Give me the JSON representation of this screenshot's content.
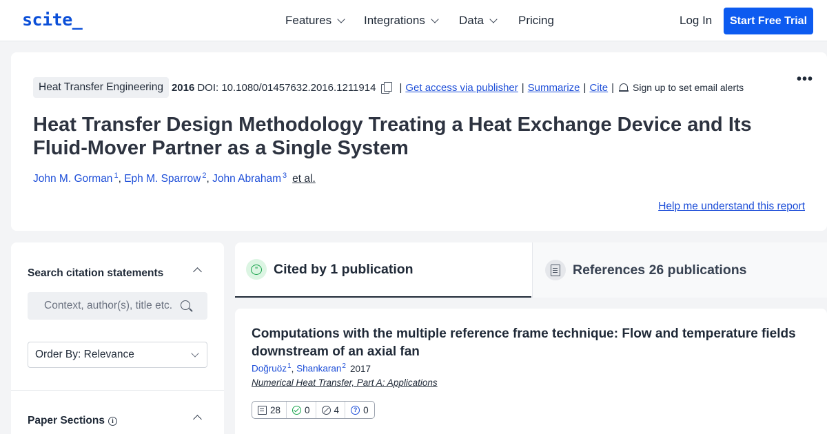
{
  "nav": {
    "logo": "scite_",
    "features": "Features",
    "integrations": "Integrations",
    "data": "Data",
    "pricing": "Pricing",
    "login": "Log In",
    "trial": "Start Free Trial"
  },
  "paper": {
    "journal": "Heat Transfer Engineering",
    "year": "2016",
    "doi": "DOI: 10.1080/01457632.2016.1211914",
    "links": {
      "access": "Get access via publisher",
      "summarize": "Summarize",
      "cite": "Cite"
    },
    "alerts": "Sign up to set email alerts",
    "more": "•••",
    "title": "Heat Transfer Design Methodology Treating a Heat Exchange Device and Its Fluid-Mover Partner as a Single System",
    "authors": [
      {
        "name": "John M. Gorman",
        "sup": "1"
      },
      {
        "name": "Eph M. Sparrow",
        "sup": "2"
      },
      {
        "name": "John Abraham",
        "sup": "3"
      }
    ],
    "etal": "et al.",
    "help": "Help me understand this report"
  },
  "sidebar": {
    "search_heading": "Search citation statements",
    "search_placeholder": "Context, author(s), title etc.",
    "order_label": "Order By: Relevance",
    "sections_heading": "Paper Sections",
    "info_glyph": "i"
  },
  "tabs": {
    "cited": "Cited by 1 publication",
    "references": "References 26 publications",
    "cited_glyph": "”"
  },
  "result": {
    "title": "Computations with the multiple reference frame technique: Flow and temperature fields downstream of an axial fan",
    "authors": [
      {
        "name": "Doğruöz",
        "sup": "1"
      },
      {
        "name": "Shankaran",
        "sup": "2"
      }
    ],
    "year": "2017",
    "journal": "Numerical Heat Transfer, Part A: Applications",
    "stats": {
      "citing": "28",
      "supporting": "0",
      "contrasting": "4",
      "mentioning": "0"
    },
    "q_glyph": "?"
  },
  "colors": {
    "brand": "#0b4fd8",
    "button": "#0d5bf0",
    "link": "#1d4ed8",
    "supporting": "#16a34a"
  },
  "icons": [
    "chevron-down-icon",
    "copy-icon",
    "bell-icon",
    "more-icon",
    "chevron-up-icon",
    "search-icon",
    "info-icon",
    "chat-icon",
    "document-icon",
    "check-icon",
    "contrast-icon",
    "question-icon"
  ]
}
